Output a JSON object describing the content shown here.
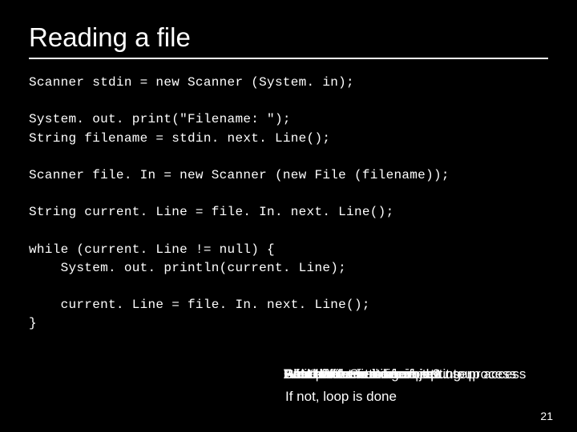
{
  "title": "Reading a file",
  "code": "Scanner stdin = new Scanner (System. in);\n\nSystem. out. print(\"Filename: \");\nString filename = stdin. next. Line();\n\nScanner file. In = new Scanner (new File (filename));\n\nString current. Line = file. In. next. Line();\n\nwhile (current. Line != null) {\n    System. out. println(current. Line);\n\n    current. Line = file. In. next. Line();\n}",
  "overlay": {
    "stack": [
      "Set up the Scanner object",
      "Get the file name from the user",
      "Read in the first line",
      "Check if there is more input to process",
      "Print the current line",
      "Read the next line",
      "While there is more input…",
      "Didn't we see this before?",
      "A lot of that was again setting up access"
    ],
    "line2": "If not, loop is done"
  },
  "pagenum": "21"
}
